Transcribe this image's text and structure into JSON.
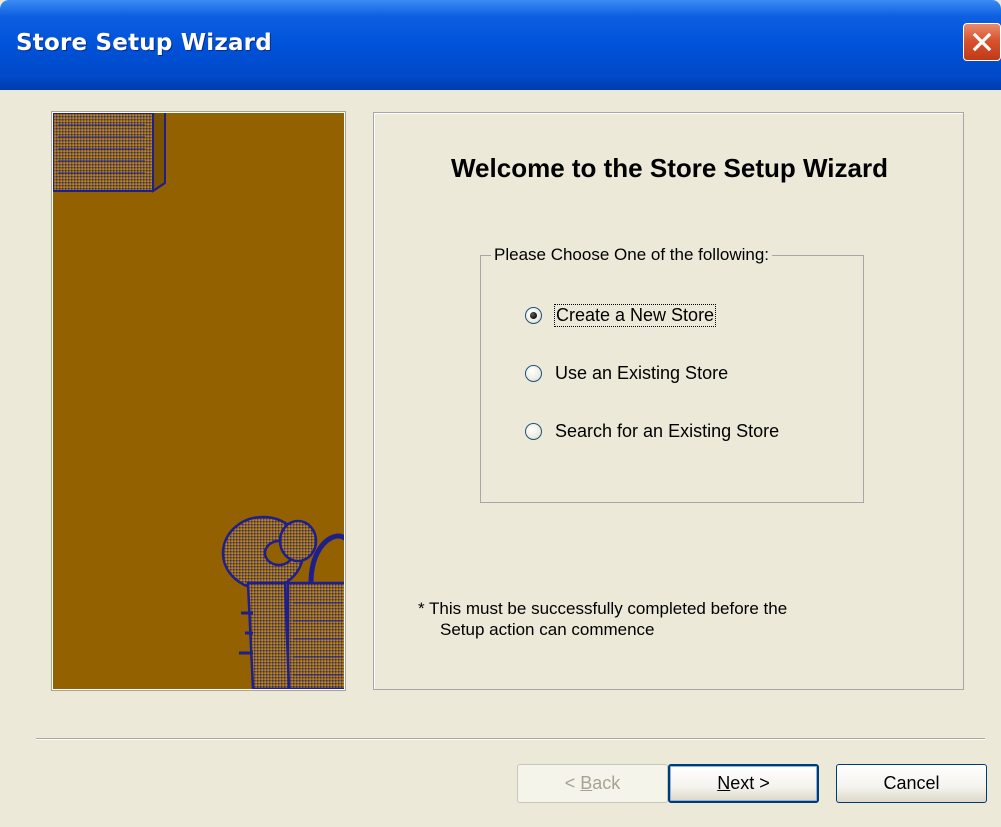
{
  "window": {
    "title": "Store Setup Wizard"
  },
  "content": {
    "heading": "Welcome to the Store Setup Wizard",
    "group_label": "Please Choose One of the following:",
    "options": [
      {
        "label": "Create a New Store",
        "checked": true
      },
      {
        "label": "Use an Existing Store",
        "checked": false
      },
      {
        "label": "Search for an Existing Store",
        "checked": false
      }
    ],
    "note_line1": "* This must be successfully completed before the",
    "note_line2": "Setup action can commence"
  },
  "buttons": {
    "back_prefix": "< ",
    "back_accel": "B",
    "back_rest": "ack",
    "next_accel": "N",
    "next_rest": "ext >",
    "cancel": "Cancel"
  },
  "colors": {
    "title_bar": "#0052D9",
    "side_image": "#946100",
    "dialog_bg": "#ECE9D8",
    "illustration_ink": "#2A2AA0"
  }
}
